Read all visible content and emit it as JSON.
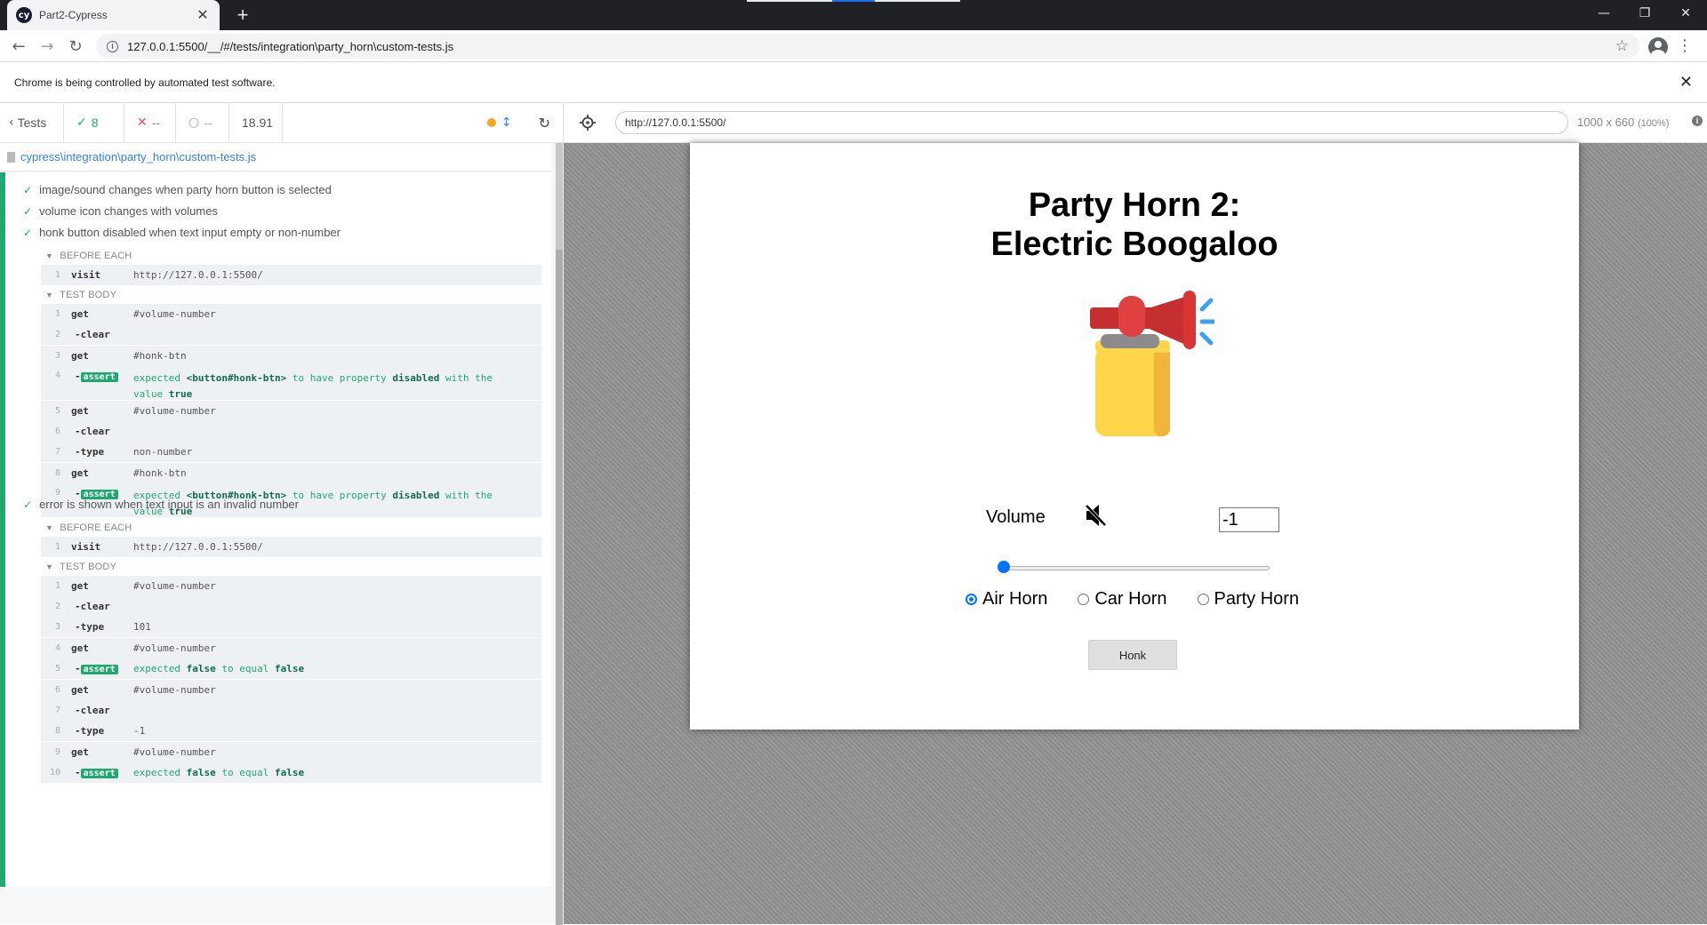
{
  "browser": {
    "tab_title": "Part2-Cypress",
    "favicon_text": "cy",
    "url": "127.0.0.1:5500/__/#/tests/integration\\party_horn\\custom-tests.js",
    "infobar_text": "Chrome is being controlled by automated test software."
  },
  "reporter": {
    "back_label": "Tests",
    "passed": "8",
    "failed": "--",
    "pending": "--",
    "duration": "18.91",
    "spec_path": "cypress\\integration\\party_horn\\custom-tests.js",
    "tests": [
      {
        "title": "image/sound changes when party horn button is selected"
      },
      {
        "title": "volume icon changes with volumes"
      },
      {
        "title": "honk button disabled when text input empty or non-number"
      },
      {
        "title": "error is shown when text input is an invalid number"
      }
    ],
    "hooks": {
      "before_each": "BEFORE EACH",
      "test_body": "TEST BODY"
    },
    "test3": {
      "before": [
        {
          "num": "1",
          "name": "visit",
          "msg": "http://127.0.0.1:5500/"
        }
      ],
      "body": [
        {
          "num": "1",
          "name": "get",
          "msg": "#volume-number"
        },
        {
          "num": "2",
          "name": "-clear",
          "msg": ""
        },
        {
          "num": "3",
          "name": "get",
          "msg": "#honk-btn"
        },
        {
          "num": "4",
          "name": "assert",
          "pre": "expected",
          "el": "<button#honk-btn>",
          "mid": "to have property",
          "prop": "disabled",
          "post": "with the",
          "post2": "value",
          "val": "true"
        },
        {
          "num": "5",
          "name": "get",
          "msg": "#volume-number"
        },
        {
          "num": "6",
          "name": "-clear",
          "msg": ""
        },
        {
          "num": "7",
          "name": "-type",
          "msg": "non-number"
        },
        {
          "num": "8",
          "name": "get",
          "msg": "#honk-btn"
        },
        {
          "num": "9",
          "name": "assert",
          "pre": "expected",
          "el": "<button#honk-btn>",
          "mid": "to have property",
          "prop": "disabled",
          "post": "with the",
          "post2": "value",
          "val": "true"
        }
      ]
    },
    "test4": {
      "before": [
        {
          "num": "1",
          "name": "visit",
          "msg": "http://127.0.0.1:5500/"
        }
      ],
      "body": [
        {
          "num": "1",
          "name": "get",
          "msg": "#volume-number"
        },
        {
          "num": "2",
          "name": "-clear",
          "msg": ""
        },
        {
          "num": "3",
          "name": "-type",
          "msg": "101"
        },
        {
          "num": "4",
          "name": "get",
          "msg": "#volume-number"
        },
        {
          "num": "5",
          "name": "assert",
          "pre": "expected",
          "a": "false",
          "mid": "to equal",
          "b": "false"
        },
        {
          "num": "6",
          "name": "get",
          "msg": "#volume-number"
        },
        {
          "num": "7",
          "name": "-clear",
          "msg": ""
        },
        {
          "num": "8",
          "name": "-type",
          "msg": "-1"
        },
        {
          "num": "9",
          "name": "get",
          "msg": "#volume-number"
        },
        {
          "num": "10",
          "name": "assert",
          "pre": "expected",
          "a": "false",
          "mid": "to equal",
          "b": "false"
        }
      ]
    }
  },
  "runner": {
    "aut_url": "http://127.0.0.1:5500/",
    "viewport": "1000 x 660",
    "zoom": "(100%)"
  },
  "app": {
    "title_line1": "Party Horn 2:",
    "title_line2": "Electric Boogaloo",
    "volume_label": "Volume",
    "volume_value": "-1",
    "slider_value": 0,
    "radios": [
      {
        "label": "Air Horn",
        "checked": true
      },
      {
        "label": "Car Horn",
        "checked": false
      },
      {
        "label": "Party Horn",
        "checked": false
      }
    ],
    "honk_label": "Honk"
  },
  "icons": {
    "back": "arrow-left-icon",
    "forward": "arrow-right-icon",
    "reload": "reload-icon",
    "star": "star-icon",
    "muted": "speaker-muted-icon",
    "horn": "air-horn-icon"
  },
  "colors": {
    "pass": "#1fa971",
    "link": "#3380ff",
    "radio": "#0075ff"
  }
}
